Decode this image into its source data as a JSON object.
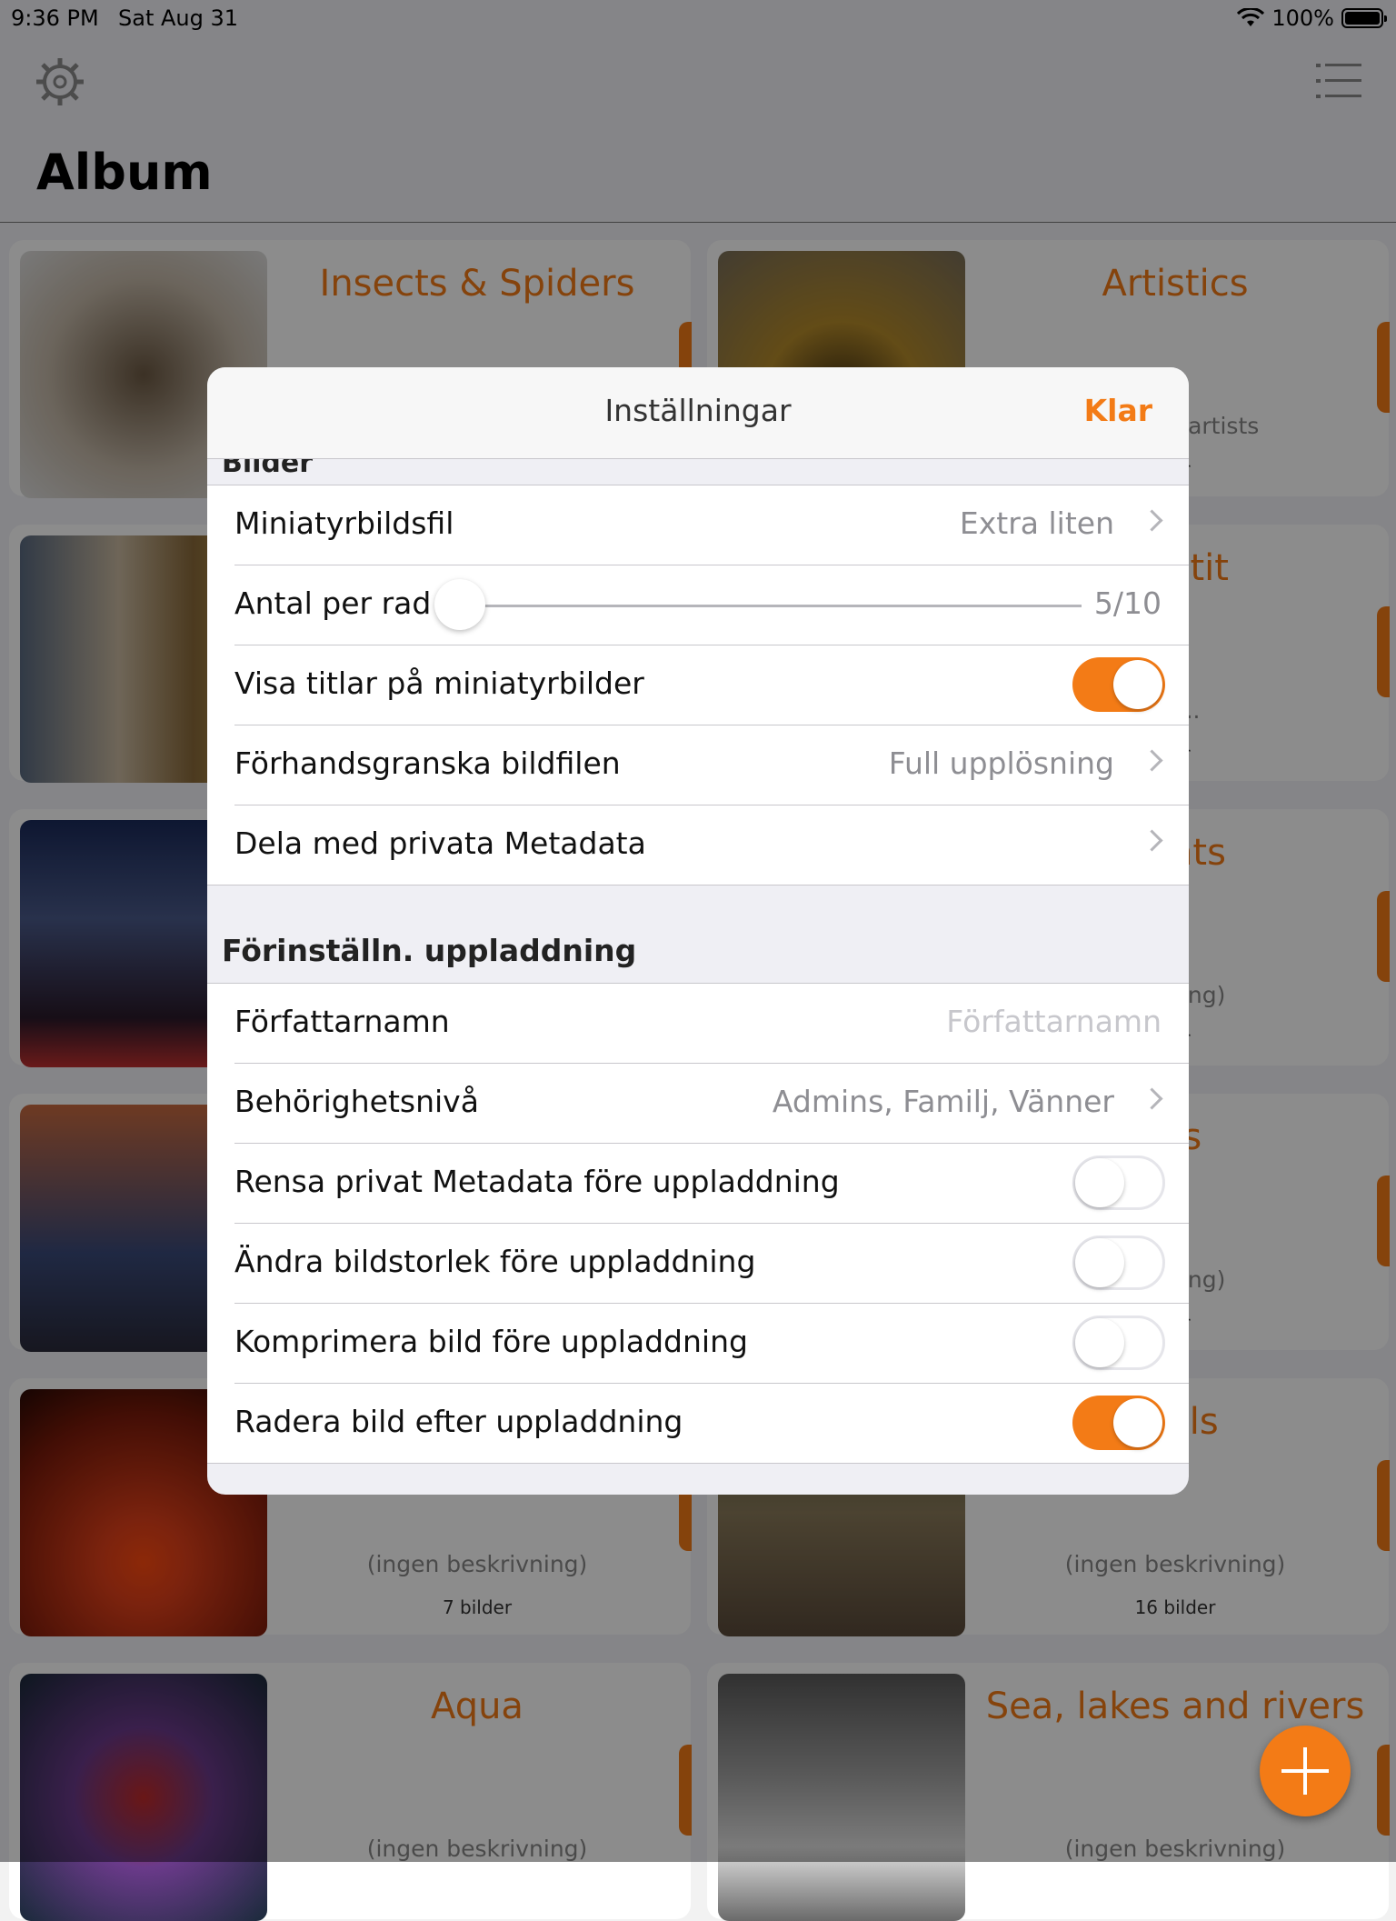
{
  "status_bar": {
    "time": "9:36 PM",
    "date": "Sat Aug 31",
    "battery": "100%"
  },
  "header": {
    "title": "Album",
    "settings_icon": "gear-icon",
    "menu_icon": "list-icon"
  },
  "albums": [
    {
      "title": "Insects & Spiders",
      "description": "",
      "count": ""
    },
    {
      "title": "Artistics",
      "description": "m great artists",
      "count": "der"
    },
    {
      "title": "",
      "description": "",
      "count": ""
    },
    {
      "title": "ppétit",
      "description": "od...",
      "count": "der"
    },
    {
      "title": "",
      "description": "",
      "count": ""
    },
    {
      "title": "nents",
      "description": "krivning)",
      "count": "der"
    },
    {
      "title": "",
      "description": "",
      "count": ""
    },
    {
      "title": "cts",
      "description": "krivning)",
      "count": "der"
    },
    {
      "title": "",
      "description": "(ingen beskrivning)",
      "count": "7 bilder"
    },
    {
      "title": "mals",
      "description": "(ingen beskrivning)",
      "count": "16 bilder"
    },
    {
      "title": "Aqua",
      "description": "(ingen beskrivning)",
      "count": ""
    },
    {
      "title": "Sea, lakes and rivers",
      "description": "(ingen beskrivning)",
      "count": ""
    }
  ],
  "colors": {
    "accent": "#f37b16",
    "separator": "#c8c7cc",
    "secondary_text": "#8e8e93"
  },
  "settings": {
    "nav_title": "Inställningar",
    "done_label": "Klar",
    "section_images_peek": "Bilder",
    "images": {
      "thumbnail_file": {
        "label": "Miniatyrbildsfil",
        "value": "Extra liten"
      },
      "per_row": {
        "label": "Antal per rad",
        "value": "5/10",
        "fraction": 0.5
      },
      "show_titles": {
        "label": "Visa titlar på miniatyrbilder",
        "on": true
      },
      "preview_file": {
        "label": "Förhandsgranska bildfilen",
        "value": "Full upplösning"
      },
      "share_metadata": {
        "label": "Dela med privata Metadata"
      }
    },
    "upload_section_title": "Förinställn. uppladdning",
    "upload": {
      "author": {
        "label": "Författarnamn",
        "placeholder": "Författarnamn"
      },
      "privacy": {
        "label": "Behörighetsnivå",
        "value": "Admins, Familj, Vänner"
      },
      "strip_metadata": {
        "label": "Rensa privat Metadata före uppladdning",
        "on": false
      },
      "resize": {
        "label": "Ändra bildstorlek före uppladdning",
        "on": false
      },
      "compress": {
        "label": "Komprimera bild före uppladdning",
        "on": false
      },
      "delete_after": {
        "label": "Radera bild efter uppladdning",
        "on": true
      }
    }
  },
  "fab_icon": "plus-icon"
}
